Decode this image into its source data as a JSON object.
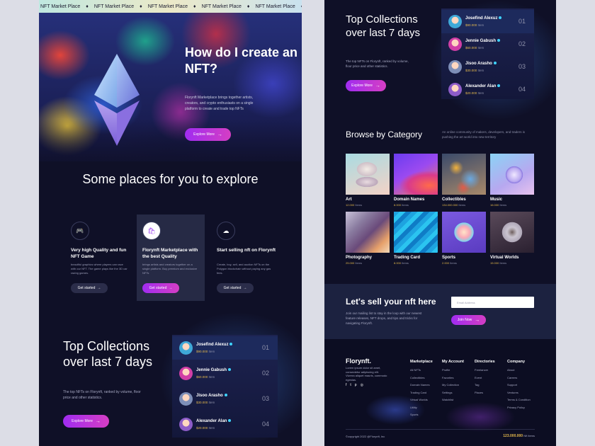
{
  "ticker": {
    "items": [
      "NFT Market Place",
      "NFT Market Place",
      "NFT Market Place",
      "NFT Market Place",
      "NFT Market Place"
    ]
  },
  "hero": {
    "title": "How do I create an NFT?",
    "description": "Florynft Marketplace brings together artists, creators, and crypto enthusiasts on a single platform to create and trade top NFTs",
    "button": "Explore More"
  },
  "explore": {
    "title": "Some places for you to explore",
    "cards": [
      {
        "icon": "gamepad-icon",
        "title": "Very high Quality and fun NFT Game",
        "desc": "beautiful graphics where players can race with our NFT. The game plays like the 3D car racing games.",
        "button": "Get started"
      },
      {
        "icon": "shop-icon",
        "title": "Florynft Marketplace with the best Quality",
        "desc": "brings artists and creators together on a single platform. Buy premium and exclusive NFTs",
        "button": "Get started"
      },
      {
        "icon": "cloud-icon",
        "title": "Start selling nft on Florynft",
        "desc": "Create, buy, sell, and auction NFTs on the Polygon blockchain without paying any gas fees.",
        "button": "Get started"
      }
    ]
  },
  "top": {
    "title": "Top Collections over last 7 days",
    "description": "The top NFTs on Florynft, ranked by volume, floor price and other statistics.",
    "button": "Explore More",
    "rankings": [
      {
        "name": "Josefind Alexuz",
        "value": "$90.000",
        "unit": "Item",
        "rank": "01",
        "color": "#3fa9d8"
      },
      {
        "name": "Jennie Gabush",
        "value": "$60.000",
        "unit": "Item",
        "rank": "02",
        "color": "#d13fa6"
      },
      {
        "name": "Jisoo Arasho",
        "value": "$30.000",
        "unit": "Item",
        "rank": "03",
        "color": "#7e8fb8"
      },
      {
        "name": "Alexander Alan",
        "value": "$20.000",
        "unit": "Item",
        "rank": "04",
        "color": "#8d5cc8"
      }
    ]
  },
  "categories": {
    "title": "Browse by Category",
    "description": "An online community of makers, developers, and traders is pushing the art world into new territory",
    "items": [
      {
        "name": "Art",
        "count": "12.000",
        "unit": "Items"
      },
      {
        "name": "Domain Names",
        "count": "8.000",
        "unit": "Items"
      },
      {
        "name": "Collectibles",
        "count": "134.000.000",
        "unit": "Items"
      },
      {
        "name": "Music",
        "count": "16.000",
        "unit": "Items"
      },
      {
        "name": "Photography",
        "count": "25.000",
        "unit": "Items"
      },
      {
        "name": "Trading Card",
        "count": "8.000",
        "unit": "Items"
      },
      {
        "name": "Sports",
        "count": "2.000",
        "unit": "Items"
      },
      {
        "name": "Virtual Worlds",
        "count": "15.000",
        "unit": "Items"
      }
    ]
  },
  "sell": {
    "title": "Let's sell your nft here",
    "description": "Join our mailing list to stay in the loop with our newest feature releases, NFT drops, and tips and tricks for navigating Florynft.",
    "email_placeholder": "Email Address",
    "button": "Join Now"
  },
  "footer": {
    "brand": "Florynft.",
    "brand_desc": "Lorem ipsum dolor sit amet, consectetur adipiscing elit. Viverra aliquet mauris, commodo egestas.",
    "social": [
      "facebook-icon",
      "twitter-icon",
      "pinterest-icon",
      "instagram-icon"
    ],
    "columns": [
      {
        "title": "Marketplace",
        "links": [
          "All NFTs",
          "Collectibles",
          "Domain Names",
          "Trading Card",
          "Virtual Worlds",
          "Utility",
          "Sports"
        ]
      },
      {
        "title": "My Account",
        "links": [
          "Profile",
          "Favorites",
          "My Collection",
          "Settings",
          "Watchlist"
        ]
      },
      {
        "title": "Directories",
        "links": [
          "Freelancer",
          "Event",
          "Tag",
          "Places"
        ]
      },
      {
        "title": "Company",
        "links": [
          "About",
          "Careers",
          "Support",
          "Ventures",
          "Terms & Condition",
          "Privacy Policy"
        ]
      }
    ],
    "copyright": "©copyright 2022 @Florynft, Inc",
    "nft_count": "123.000.000",
    "nft_label": "Nft items"
  }
}
